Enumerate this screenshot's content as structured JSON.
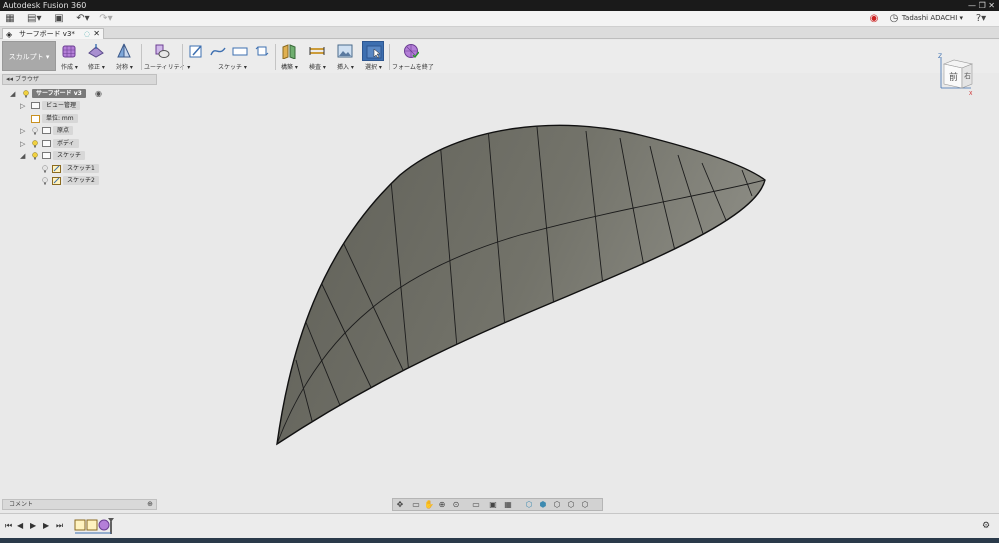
{
  "window": {
    "title": "Autodesk Fusion 360",
    "controls": "—  ❐  ✕"
  },
  "appbar": {
    "user": "Tadashi ADACHI ▾"
  },
  "document": {
    "tab_title": "サーフボード v3*"
  },
  "workspace": {
    "label": "スカルプト ▾"
  },
  "toolbar": {
    "groups": [
      {
        "label": "作成 ▾"
      },
      {
        "label": "修正 ▾"
      },
      {
        "label": "対称 ▾"
      },
      {
        "label": "ユーティリティ ▾"
      },
      {
        "label": "スケッチ ▾"
      },
      {
        "label": "構築 ▾"
      },
      {
        "label": "検査 ▾"
      },
      {
        "label": "挿入 ▾"
      },
      {
        "label": "選択 ▾"
      },
      {
        "label": "フォームを終了"
      }
    ]
  },
  "viewcube": {
    "face_front": "前",
    "face_right": "右",
    "axis_z": "Z",
    "axis_x": "X"
  },
  "browser": {
    "title": "ブラウザ",
    "root": "サーフボード v3",
    "items": [
      {
        "label": "ビュー管理"
      },
      {
        "label": "単位: mm"
      },
      {
        "label": "原点"
      },
      {
        "label": "ボディ"
      },
      {
        "label": "スケッチ"
      },
      {
        "label": "スケッチ1"
      },
      {
        "label": "スケッチ2"
      }
    ]
  },
  "comments": {
    "label": "コメント"
  },
  "colors": {
    "accent": "#3d6fb0",
    "surface": "#707066",
    "surface_light": "#8a8a80",
    "root_label": "#7a7a7a"
  }
}
